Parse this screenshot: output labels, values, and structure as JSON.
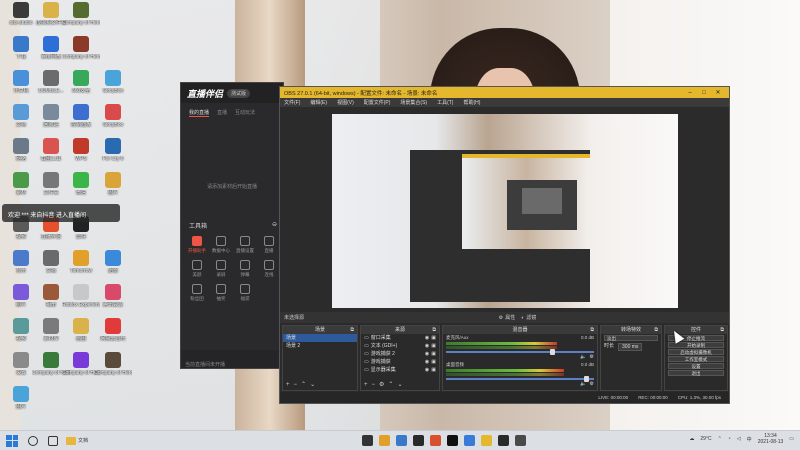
{
  "desktop_icons": [
    {
      "label": "obs-studio",
      "color": "#3a3a3a"
    },
    {
      "label": "虚拟机文件夹",
      "color": "#d9b24a"
    },
    {
      "label": "Company of Heroes",
      "color": "#556b2f"
    },
    {
      "label": "下载",
      "color": "#3a78c9"
    },
    {
      "label": "百度网盘",
      "color": "#2d6fd6"
    },
    {
      "label": "Company of Heroes",
      "color": "#8b3a2a"
    },
    {
      "label": "计算机",
      "color": "#4a90d9"
    },
    {
      "label": "DUMBLE...",
      "color": "#6b6b6b"
    },
    {
      "label": "360安全",
      "color": "#38a85a"
    },
    {
      "label": "StoryBoo",
      "color": "#4aa3d9"
    },
    {
      "label": "文档",
      "color": "#5a9ad6"
    },
    {
      "label": "回收站",
      "color": "#7a8a9a"
    },
    {
      "label": "控制面板",
      "color": "#3c6fd0"
    },
    {
      "label": "StoryBoo",
      "color": "#d94a4a"
    },
    {
      "label": "网络",
      "color": "#6a7a8a"
    },
    {
      "label": "截图工具",
      "color": "#d9534f"
    },
    {
      "label": "WPS",
      "color": "#c03a2b"
    },
    {
      "label": "For Cry 6",
      "color": "#2a6ab0"
    },
    {
      "label": "素材",
      "color": "#4a9a4a"
    },
    {
      "label": "文件夹",
      "color": "#777777"
    },
    {
      "label": "微信",
      "color": "#3ab54a"
    },
    {
      "label": "图片",
      "color": "#d9a43a"
    },
    {
      "label": "视频",
      "color": "#5a5a5a"
    },
    {
      "label": "直播伴侣",
      "color": "#e5502d"
    },
    {
      "label": "剪映",
      "color": "#222222"
    },
    {
      "label": "音乐",
      "color": "#4a7ac9"
    },
    {
      "label": "文档",
      "color": "#6a6a6a"
    },
    {
      "label": "Tomorrow",
      "color": "#e0a02a"
    },
    {
      "label": "迅雷",
      "color": "#3a8ad9"
    },
    {
      "label": "照片",
      "color": "#7a5ad9"
    },
    {
      "label": "相册",
      "color": "#9a5a3a"
    },
    {
      "label": "Roblox Experience",
      "color": "#c8c8c8"
    },
    {
      "label": "腾讯会议",
      "color": "#d94a6a"
    },
    {
      "label": "视频",
      "color": "#5a9a9a"
    },
    {
      "label": "素材库",
      "color": "#7a7a7a"
    },
    {
      "label": "画图",
      "color": "#d9b24a"
    },
    {
      "label": "网易云音乐",
      "color": "#e03a3a"
    },
    {
      "label": "设置",
      "color": "#8a8a8a"
    },
    {
      "label": "Company of Heroes - 3",
      "color": "#3a7a3a"
    },
    {
      "label": "Company of Heroes - 2",
      "color": "#7a3ad9"
    },
    {
      "label": "Company of Heroes",
      "color": "#5a4a3a"
    },
    {
      "label": "图片",
      "color": "#4aa3d9"
    },
    {
      "label": "下载",
      "color": "#e07a2a"
    },
    {
      "label": "Company of Heroes",
      "color": "#5a6a3a"
    }
  ],
  "toast": {
    "text": "欢迎 *** 来自抖音 进入直播间"
  },
  "live_app": {
    "logo": "直播伴侣",
    "version": "测试版",
    "tabs": [
      "我的直播",
      "直播",
      "互动玩法"
    ],
    "hint": "请添加素材后开始直播",
    "tools_title": "工具箱",
    "tools": [
      {
        "label": "开播助手",
        "red": true
      },
      {
        "label": "数据中心",
        "red": false
      },
      {
        "label": "直播设置",
        "red": false
      },
      {
        "label": "直播",
        "red": false
      },
      {
        "label": "美颜",
        "red": false
      },
      {
        "label": "录屏",
        "red": false
      },
      {
        "label": "弹幕",
        "red": false
      },
      {
        "label": "连线",
        "red": false
      },
      {
        "label": "粉丝团",
        "red": false
      },
      {
        "label": "抽奖",
        "red": false
      },
      {
        "label": "福袋",
        "red": false
      }
    ],
    "footer": "当前直播间未开播"
  },
  "obs": {
    "title": "OBS 27.0.1 (64-bit, windows) - 配置文件: 未命名 - 场景: 未命名",
    "menu": [
      "文件(F)",
      "编辑(E)",
      "视图(V)",
      "配置文件(P)",
      "场景集合(S)",
      "工具(T)",
      "帮助(H)"
    ],
    "source_bar": {
      "label": "未选择源",
      "props": "属性",
      "filters": "滤镜"
    },
    "scenes": {
      "title": "场景",
      "items": [
        "场景",
        "场景 2"
      ]
    },
    "sources": {
      "title": "来源",
      "items": [
        "窗口采集",
        "文本 (GDI+)",
        "游戏捕获 2",
        "游戏捕获",
        "显示器采集"
      ]
    },
    "mixer": {
      "title": "混音器",
      "channels": [
        {
          "name": "麦克风/Aux",
          "db": "0.0 dB",
          "level": 0.75,
          "fader": 0.72
        },
        {
          "name": "桌面音频",
          "db": "0.0 dB",
          "level": 0.8,
          "fader": 0.95
        }
      ]
    },
    "transitions": {
      "title": "转场特效",
      "type": "淡出",
      "duration_label": "时长",
      "duration": "300 ms"
    },
    "controls": {
      "title": "控件",
      "buttons": [
        "停止推流",
        "开始录制",
        "启动虚拟摄像机",
        "工作室模式",
        "设置",
        "退出"
      ]
    },
    "status": {
      "live": "LIVE: 00:00:00",
      "rec": "REC: 00:00:00",
      "cpu": "CPU: 1.3%, 30.00 fps"
    }
  },
  "taskbar": {
    "file_label": "文档",
    "app_colors": [
      "#333333",
      "#e0a02a",
      "#3a78c9",
      "#2a2a2a",
      "#d9502d",
      "#111111",
      "#3a7ad9",
      "#e5b72d",
      "#2a2a2a",
      "#4a4a4a"
    ],
    "weather": "29°C",
    "time": "13:34",
    "date": "2021-08-13"
  }
}
